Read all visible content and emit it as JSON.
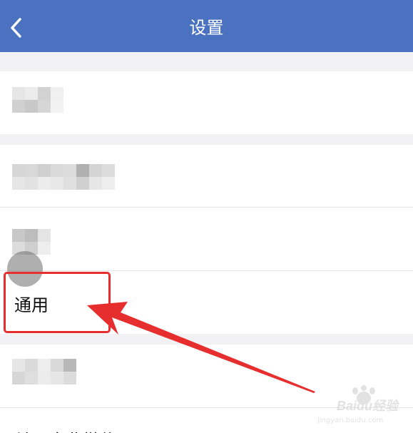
{
  "header": {
    "title": "设置",
    "back_icon": "chevron-left-icon"
  },
  "rows": {
    "general": {
      "label": "通用"
    },
    "bottom": {
      "label": "关于企业微信"
    }
  },
  "highlight": {
    "color": "#e62e2e"
  },
  "watermark": {
    "text": "Baidu经验",
    "sub": "jingyan.baidu.com"
  },
  "colors": {
    "header_bg": "#4a72c0",
    "accent_red": "#e62e2e"
  }
}
